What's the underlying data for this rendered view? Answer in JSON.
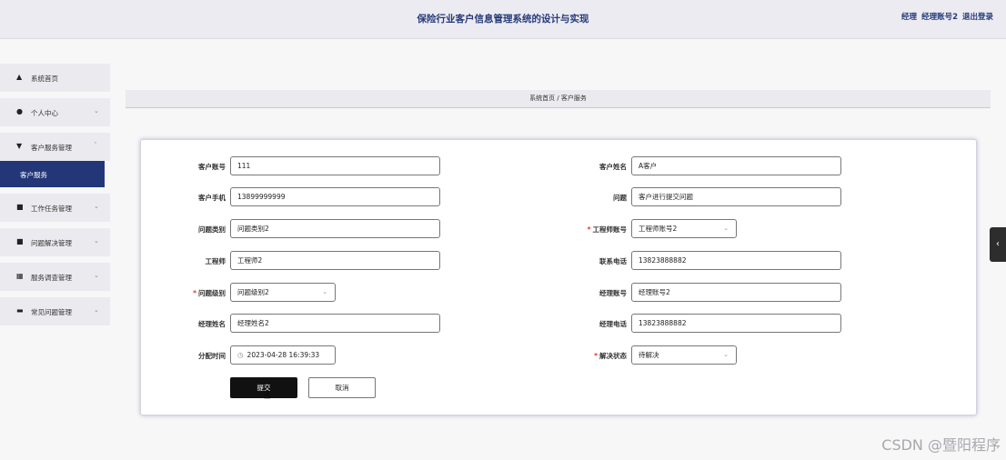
{
  "header": {
    "title": "保险行业客户信息管理系统的设计与实现",
    "user_role": "经理",
    "user_name": "经理账号2",
    "logout": "退出登录"
  },
  "sidebar": {
    "items": [
      {
        "label": "系统首页",
        "icon": "home-icon"
      },
      {
        "label": "个人中心",
        "icon": "user-icon"
      },
      {
        "label": "客户服务管理",
        "icon": "service-icon"
      },
      {
        "label": "工作任务管理",
        "icon": "task-icon"
      },
      {
        "label": "问题解决管理",
        "icon": "solve-icon"
      },
      {
        "label": "服务调查管理",
        "icon": "grid-icon"
      },
      {
        "label": "常见问题管理",
        "icon": "faq-icon"
      }
    ],
    "active_sub": "客户服务"
  },
  "breadcrumb": "系统首页 / 客户服务",
  "form": {
    "customer_account_label": "客户账号",
    "customer_account": "111",
    "customer_name_label": "客户姓名",
    "customer_name": "A客户",
    "customer_phone_label": "客户手机",
    "customer_phone": "13899999999",
    "question_label": "问题",
    "question": "客户进行提交问题",
    "question_type_label": "问题类别",
    "question_type": "问题类别2",
    "engineer_account_label": "工程师账号",
    "engineer_account": "工程师账号2",
    "engineer_label": "工程师",
    "engineer": "工程师2",
    "contact_phone_label": "联系电话",
    "contact_phone": "13823888882",
    "question_level_label": "问题级别",
    "question_level": "问题级别2",
    "manager_account_label": "经理账号",
    "manager_account": "经理账号2",
    "manager_name_label": "经理姓名",
    "manager_name": "经理姓名2",
    "manager_phone_label": "经理电话",
    "manager_phone": "13823888882",
    "assign_time_label": "分配时间",
    "assign_time": "2023-04-28 16:39:33",
    "status_label": "解决状态",
    "status": "待解决",
    "submit": "提交",
    "cancel": "取消"
  },
  "watermark": "CSDN @暨阳程序"
}
